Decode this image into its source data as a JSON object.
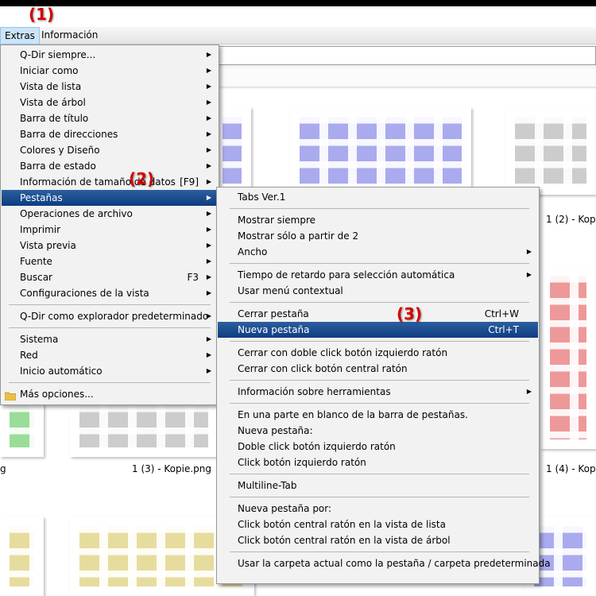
{
  "menubar": {
    "items": [
      "Extras",
      "Información"
    ]
  },
  "annotations": [
    "(1)",
    "(2)",
    "(3)"
  ],
  "thumbnails": [
    {
      "color": "#aaaaee",
      "caption": ""
    },
    {
      "color": "#aaaaee",
      "caption": ""
    },
    {
      "color": "#cccccc",
      "caption": "1 (2) - Kopie"
    },
    {
      "color": "#ee9999",
      "caption": ""
    },
    {
      "color": "#99dd99",
      "caption": "1 (3) - Kopie.png"
    },
    {
      "color": "#cccccc",
      "caption": "1 (4) - Kopie"
    },
    {
      "color": "#e6dc9e",
      "caption": ""
    },
    {
      "color": "#e6dc9e",
      "caption": ""
    },
    {
      "color": "#aaaaee",
      "caption": ""
    }
  ],
  "captions": {
    "left_partial": "g",
    "mid": "1 (3) - Kopie.png",
    "right_top": "1 (2) - Kopie",
    "right_bottom": "1 (4) - Kopie"
  },
  "extras_menu": {
    "items": [
      {
        "label": "Q-Dir siempre...",
        "shortcut": "",
        "submenu": true
      },
      {
        "label": "Iniciar como",
        "shortcut": "",
        "submenu": true
      },
      {
        "label": "Vista de lista",
        "shortcut": "",
        "submenu": true
      },
      {
        "label": "Vista de árbol",
        "shortcut": "",
        "submenu": true
      },
      {
        "label": "Barra de título",
        "shortcut": "",
        "submenu": true
      },
      {
        "label": "Barra de direcciones",
        "shortcut": "",
        "submenu": true
      },
      {
        "label": "Colores y Diseño",
        "shortcut": "",
        "submenu": true
      },
      {
        "label": "Barra de estado",
        "shortcut": "",
        "submenu": true
      },
      {
        "label": "Información de tamaño de datos",
        "shortcut": "[F9]",
        "submenu": true
      },
      {
        "label": "Pestañas",
        "shortcut": "",
        "submenu": true,
        "highlighted": true
      },
      {
        "label": "Operaciones de archivo",
        "shortcut": "",
        "submenu": true
      },
      {
        "label": "Imprimir",
        "shortcut": "",
        "submenu": true
      },
      {
        "label": "Vista previa",
        "shortcut": "",
        "submenu": true
      },
      {
        "label": "Fuente",
        "shortcut": "",
        "submenu": true
      },
      {
        "label": "Buscar",
        "shortcut": "F3",
        "submenu": true
      },
      {
        "label": "Configuraciones de la vista",
        "shortcut": "",
        "submenu": true
      },
      {
        "separator": true
      },
      {
        "label": "Q-Dir como explorador predeterminado",
        "shortcut": "",
        "submenu": true
      },
      {
        "separator": true
      },
      {
        "label": "Sistema",
        "shortcut": "",
        "submenu": true
      },
      {
        "label": "Red",
        "shortcut": "",
        "submenu": true
      },
      {
        "label": "Inicio automático",
        "shortcut": "",
        "submenu": true
      },
      {
        "separator": true
      },
      {
        "label": "Más opciones...",
        "shortcut": "",
        "submenu": false,
        "icon": "folder-icon"
      }
    ]
  },
  "tabs_menu": {
    "items": [
      {
        "label": "Tabs Ver.1",
        "shortcut": "",
        "submenu": false
      },
      {
        "separator": true
      },
      {
        "label": "Mostrar siempre",
        "shortcut": "",
        "submenu": false
      },
      {
        "label": "Mostrar sólo a partir de 2",
        "shortcut": "",
        "submenu": false
      },
      {
        "label": "Ancho",
        "shortcut": "",
        "submenu": true
      },
      {
        "separator": true
      },
      {
        "label": "Tiempo de retardo para selección automática",
        "shortcut": "",
        "submenu": true
      },
      {
        "label": "Usar menú contextual",
        "shortcut": "",
        "submenu": false
      },
      {
        "separator": true
      },
      {
        "label": "Cerrar pestaña",
        "shortcut": "Ctrl+W",
        "submenu": false
      },
      {
        "label": "Nueva pestaña",
        "shortcut": "Ctrl+T",
        "submenu": false,
        "highlighted": true
      },
      {
        "separator": true
      },
      {
        "label": "Cerrar con doble click botón izquierdo ratón",
        "shortcut": "",
        "submenu": false
      },
      {
        "label": "Cerrar con click botón central ratón",
        "shortcut": "",
        "submenu": false
      },
      {
        "separator": true
      },
      {
        "label": "Información sobre herramientas",
        "shortcut": "",
        "submenu": true
      },
      {
        "separator": true
      },
      {
        "label": "En una parte en blanco de la barra de pestañas.",
        "shortcut": "",
        "submenu": false
      },
      {
        "label": "Nueva pestaña:",
        "shortcut": "",
        "submenu": false
      },
      {
        "label": "Doble click botón izquierdo ratón",
        "shortcut": "",
        "submenu": false
      },
      {
        "label": "Click botón izquierdo ratón",
        "shortcut": "",
        "submenu": false
      },
      {
        "separator": true
      },
      {
        "label": "Multiline-Tab",
        "shortcut": "",
        "submenu": false
      },
      {
        "separator": true
      },
      {
        "label": "Nueva pestaña por:",
        "shortcut": "",
        "submenu": false
      },
      {
        "label": "Click botón central ratón en la vista de lista",
        "shortcut": "",
        "submenu": false
      },
      {
        "label": "Click botón central ratón en la vista de árbol",
        "shortcut": "",
        "submenu": false
      },
      {
        "separator": true
      },
      {
        "label": "Usar la carpeta actual como la pestaña / carpeta predeterminada",
        "shortcut": "",
        "submenu": false
      }
    ]
  }
}
